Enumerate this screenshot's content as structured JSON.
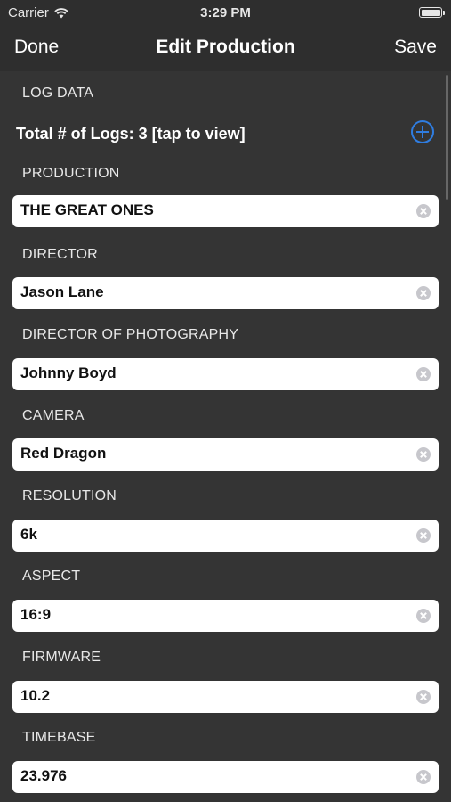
{
  "status_bar": {
    "carrier": "Carrier",
    "time": "3:29 PM",
    "icons": [
      "wifi-icon",
      "battery-icon"
    ]
  },
  "nav": {
    "left_label": "Done",
    "title": "Edit Production",
    "right_label": "Save"
  },
  "log_section": {
    "header": "LOG DATA",
    "summary": "Total # of  Logs: 3 [tap to view]",
    "add_icon": "plus-circle-icon",
    "accent_color": "#2f7de1"
  },
  "fields": [
    {
      "label": "PRODUCTION",
      "value": "THE GREAT ONES"
    },
    {
      "label": "DIRECTOR",
      "value": "Jason Lane"
    },
    {
      "label": "DIRECTOR OF PHOTOGRAPHY",
      "value": "Johnny Boyd"
    },
    {
      "label": "CAMERA",
      "value": "Red Dragon"
    },
    {
      "label": "RESOLUTION",
      "value": "6k"
    },
    {
      "label": "ASPECT",
      "value": "16:9"
    },
    {
      "label": "FIRMWARE",
      "value": "10.2"
    },
    {
      "label": "TIMEBASE",
      "value": "23.976"
    }
  ]
}
